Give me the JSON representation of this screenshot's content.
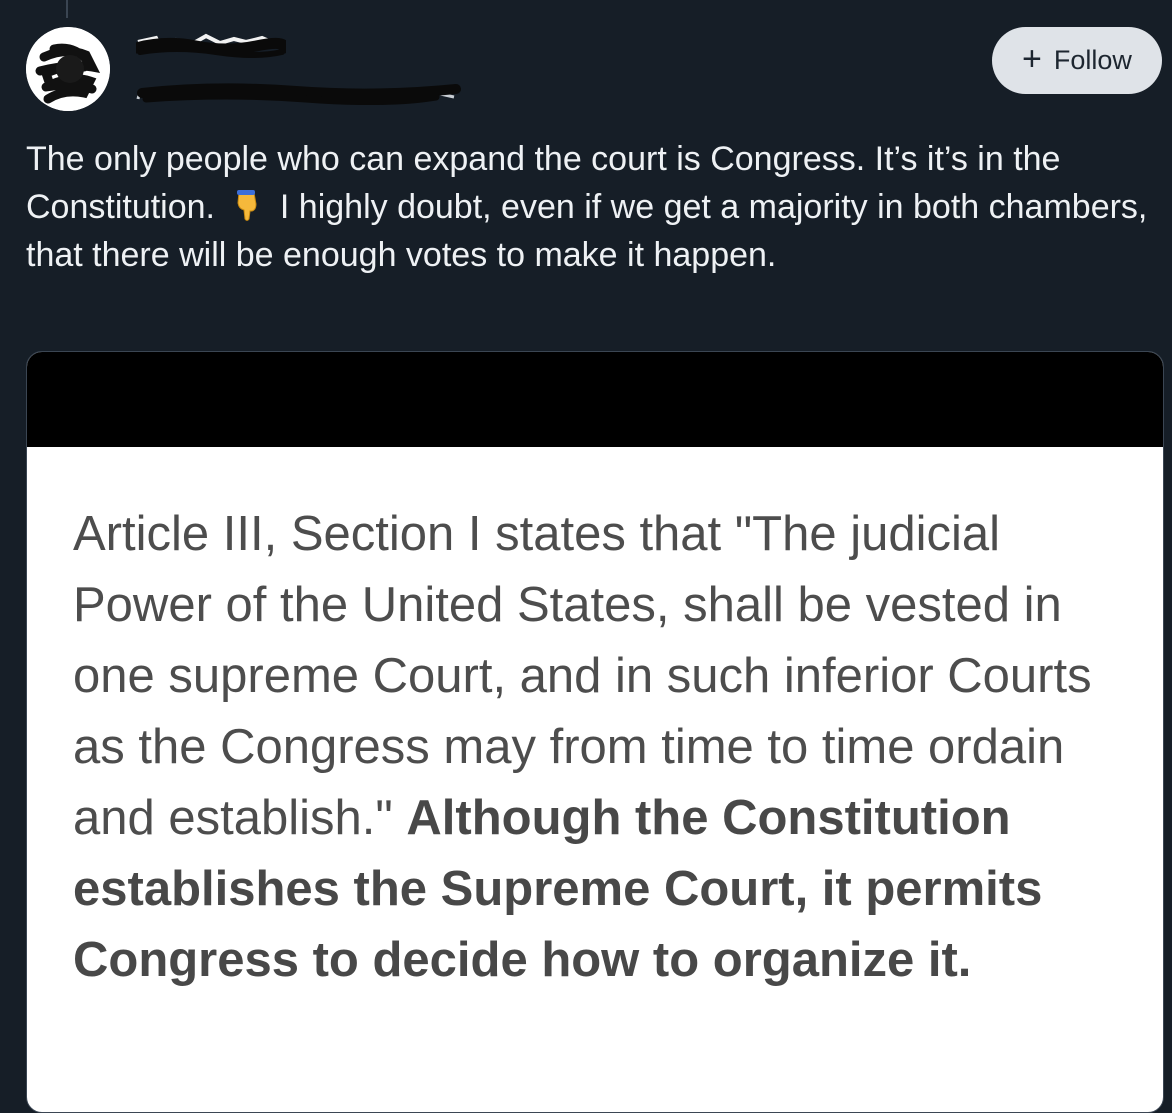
{
  "post": {
    "follow_button": {
      "icon": "plus-icon",
      "label": "Follow"
    },
    "text_parts": [
      "The only people who can expand the court is Congress. It’s it’s in the Constitution.",
      "I highly doubt, even if we get a majority in both chambers, that there will be enough votes to make it happen."
    ],
    "emoji": "backhand-index-pointing-down"
  },
  "embed": {
    "quote": "Article III, Section I states that \"The judicial Power of the United States, shall be vested in one supreme Court, and in such inferior Courts as the Congress may from time to time ordain and establish.\"",
    "emphasis": "Although the Constitution establishes the Supreme Court, it permits Congress to decide how to organize it."
  },
  "colors": {
    "background": "#161e27",
    "follow_button_bg": "#dfe3e8",
    "text": "#eef1f4",
    "embed_text": "#4d4d4d"
  }
}
